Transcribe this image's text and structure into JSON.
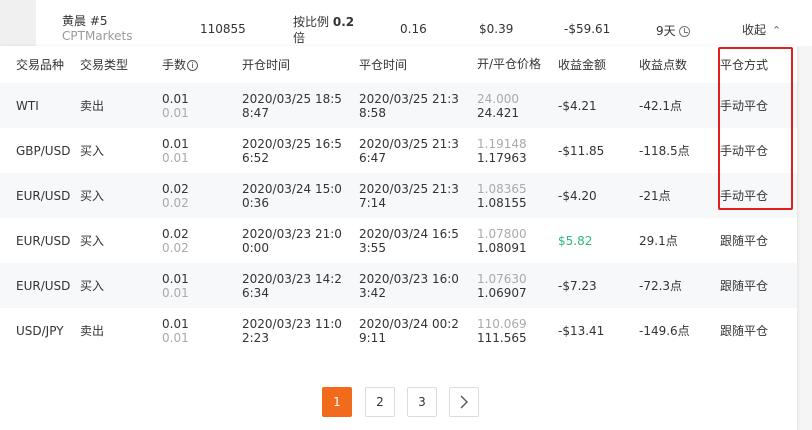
{
  "summary": {
    "name": "黄晨 #5",
    "broker": "CPTMarkets",
    "id": "110855",
    "ratio_prefix": "按比例",
    "ratio_value": "0.2",
    "ratio_suffix": "倍",
    "lots": "0.16",
    "commission": "$0.39",
    "profit": "-$59.61",
    "duration": "9天",
    "collapse_label": "收起",
    "collapse_icon": "chevron-up-icon"
  },
  "table": {
    "headers": [
      "交易品种",
      "交易类型",
      "手数",
      "开仓时间",
      "平仓时间",
      "开/平仓价格",
      "收益金额",
      "收益点数",
      "平仓方式"
    ],
    "rows": [
      {
        "symbol": "WTI",
        "type": "卖出",
        "lots": "0.01",
        "lots_sub": "0.01",
        "open_time": "2020/03/25 18:58:47",
        "close_time": "2020/03/25 21:38:58",
        "open_price": "24.000",
        "close_price": "24.421",
        "amount": "-$4.21",
        "points": "-42.1点",
        "close_mode": "手动平仓"
      },
      {
        "symbol": "GBP/USD",
        "type": "买入",
        "lots": "0.01",
        "lots_sub": "0.01",
        "open_time": "2020/03/25 16:56:52",
        "close_time": "2020/03/25 21:36:47",
        "open_price": "1.19148",
        "close_price": "1.17963",
        "amount": "-$11.85",
        "points": "-118.5点",
        "close_mode": "手动平仓"
      },
      {
        "symbol": "EUR/USD",
        "type": "买入",
        "lots": "0.02",
        "lots_sub": "0.02",
        "open_time": "2020/03/24 15:00:36",
        "close_time": "2020/03/25 21:37:14",
        "open_price": "1.08365",
        "close_price": "1.08155",
        "amount": "-$4.20",
        "points": "-21点",
        "close_mode": "手动平仓"
      },
      {
        "symbol": "EUR/USD",
        "type": "买入",
        "lots": "0.02",
        "lots_sub": "0.02",
        "open_time": "2020/03/23 21:00:00",
        "close_time": "2020/03/24 16:53:55",
        "open_price": "1.07800",
        "close_price": "1.08091",
        "amount": "$5.82",
        "points": "29.1点",
        "close_mode": "跟随平仓"
      },
      {
        "symbol": "EUR/USD",
        "type": "买入",
        "lots": "0.01",
        "lots_sub": "0.01",
        "open_time": "2020/03/23 14:26:34",
        "close_time": "2020/03/23 16:03:42",
        "open_price": "1.07630",
        "close_price": "1.06907",
        "amount": "-$7.23",
        "points": "-72.3点",
        "close_mode": "跟随平仓"
      },
      {
        "symbol": "USD/JPY",
        "type": "卖出",
        "lots": "0.01",
        "lots_sub": "0.01",
        "open_time": "2020/03/23 11:02:23",
        "close_time": "2020/03/24 00:29:11",
        "open_price": "110.069",
        "close_price": "111.565",
        "amount": "-$13.41",
        "points": "-149.6点",
        "close_mode": "跟随平仓"
      }
    ]
  },
  "pagination": {
    "pages": [
      "1",
      "2",
      "3"
    ],
    "current": "1",
    "next_icon": "chevron-right-icon"
  },
  "colors": {
    "accent": "#f26a1b",
    "positive": "#2db87d",
    "highlight": "#e02020"
  }
}
